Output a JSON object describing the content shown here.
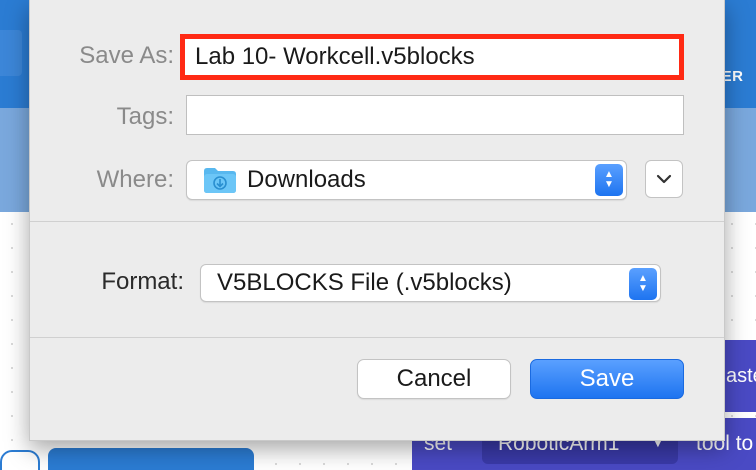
{
  "background": {
    "header_partial_text": "LER",
    "block_text_partial": "aste",
    "set_label": "set",
    "arm_dropdown": "RoboticArm1",
    "tool_text_partial": "tool to"
  },
  "dialog": {
    "save_as_label": "Save As:",
    "filename_value": "Lab 10- Workcell.v5blocks",
    "tags_label": "Tags:",
    "tags_value": "",
    "where_label": "Where:",
    "where_value": "Downloads",
    "where_icon": "downloads-folder-icon",
    "format_label": "Format:",
    "format_value": "V5BLOCKS File (.v5blocks)",
    "cancel_label": "Cancel",
    "save_label": "Save"
  },
  "colors": {
    "highlight_border": "#ff2a14",
    "accent_blue": "#1e74f0"
  }
}
